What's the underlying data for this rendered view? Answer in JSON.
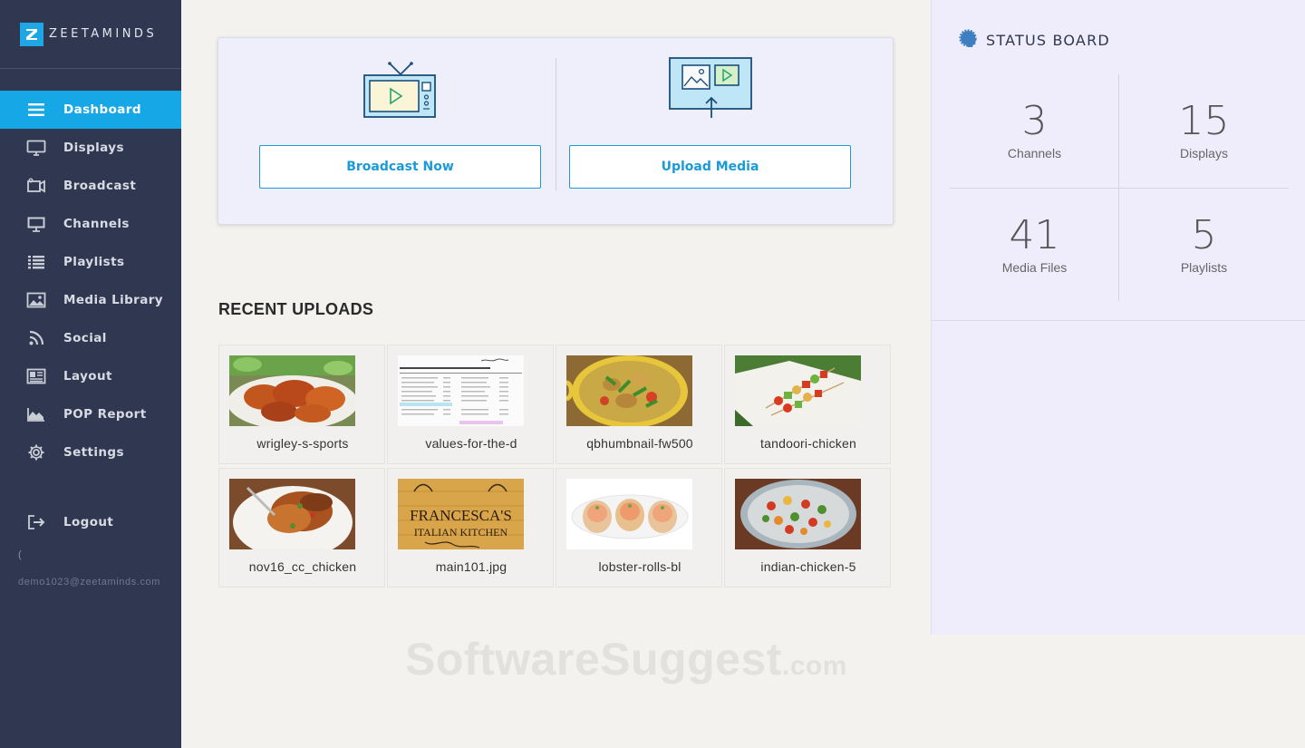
{
  "brand": {
    "name": "ZEETAMINDS"
  },
  "sidebar": {
    "items": [
      {
        "label": "Dashboard",
        "icon": "hamburger-icon",
        "active": true
      },
      {
        "label": "Displays",
        "icon": "monitor-icon"
      },
      {
        "label": "Broadcast",
        "icon": "video-camera-icon"
      },
      {
        "label": "Channels",
        "icon": "screen-icon"
      },
      {
        "label": "Playlists",
        "icon": "list-icon"
      },
      {
        "label": "Media Library",
        "icon": "image-icon"
      },
      {
        "label": "Social",
        "icon": "rss-icon"
      },
      {
        "label": "Layout",
        "icon": "layout-icon"
      },
      {
        "label": "POP Report",
        "icon": "area-chart-icon"
      },
      {
        "label": "Settings",
        "icon": "gear-icon"
      }
    ],
    "logout_label": "Logout",
    "paren": "(",
    "user_email": "demo1023@zeetaminds.com"
  },
  "actions": {
    "broadcast_label": "Broadcast Now",
    "upload_label": "Upload Media"
  },
  "recent": {
    "title": "RECENT UPLOADS",
    "items": [
      {
        "name": "wrigley-s-sports"
      },
      {
        "name": "values-for-the-d"
      },
      {
        "name": "qbhumbnail-fw500"
      },
      {
        "name": "tandoori-chicken"
      },
      {
        "name": "nov16_cc_chicken"
      },
      {
        "name": "main101.jpg"
      },
      {
        "name": "lobster-rolls-bl"
      },
      {
        "name": "indian-chicken-5"
      }
    ],
    "thumb_texts": {
      "kitchen_line1": "FRANCESCA'S",
      "kitchen_line2": "ITALIAN KITCHEN"
    }
  },
  "status": {
    "title": "STATUS BOARD",
    "stats": [
      {
        "value": "3",
        "label": "Channels"
      },
      {
        "value": "15",
        "label": "Displays"
      },
      {
        "value": "41",
        "label": "Media Files"
      },
      {
        "value": "5",
        "label": "Playlists"
      }
    ]
  },
  "watermark": {
    "main": "SoftwareSuggest",
    "suffix": ".com"
  },
  "colors": {
    "accent": "#16a8e6",
    "sidebar": "#2f3850",
    "status_bg": "#efedfb"
  }
}
